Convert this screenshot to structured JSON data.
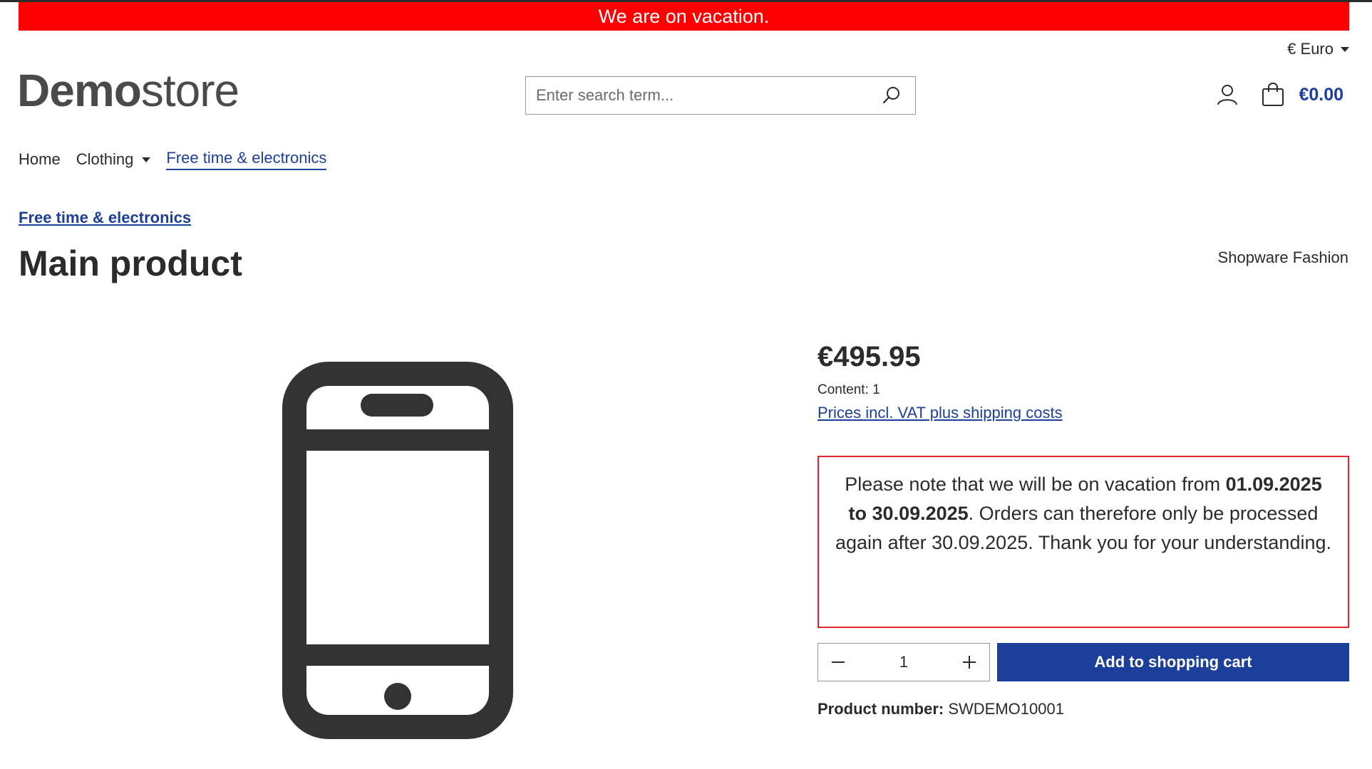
{
  "banner": {
    "text": "We are on vacation.",
    "color": "#ff0000"
  },
  "header": {
    "currency": "€ Euro",
    "logo_bold": "Demo",
    "logo_light": "store",
    "search_placeholder": "Enter search term...",
    "cart_total": "€0.00",
    "icons": {
      "search": "search-icon",
      "account": "user-icon",
      "cart": "shopping-bag-icon"
    }
  },
  "nav": {
    "items": [
      {
        "label": "Home"
      },
      {
        "label": "Clothing",
        "dropdown": true
      },
      {
        "label": "Free time & electronics",
        "active": true
      }
    ]
  },
  "breadcrumb": "Free time & electronics",
  "product": {
    "title": "Main product",
    "manufacturer": "Shopware Fashion",
    "image_icon": "smartphone-icon",
    "price": "€495.95",
    "content_label": "Content: 1",
    "vat_link": "Prices incl. VAT plus shipping costs",
    "notice": {
      "before": "Please note that we will be on vacation from ",
      "dates": "01.09.2025 to 30.09.2025",
      "after": ". Orders can therefore only be processed again after 30.09.2025. Thank you for your understanding."
    },
    "quantity": "1",
    "add_to_cart": "Add to shopping cart",
    "product_number_label": "Product number:",
    "product_number_value": "SWDEMO10001"
  },
  "colors": {
    "accent": "#1c3f9b",
    "banner": "#ff0000",
    "notice_border": "#e0242b"
  }
}
